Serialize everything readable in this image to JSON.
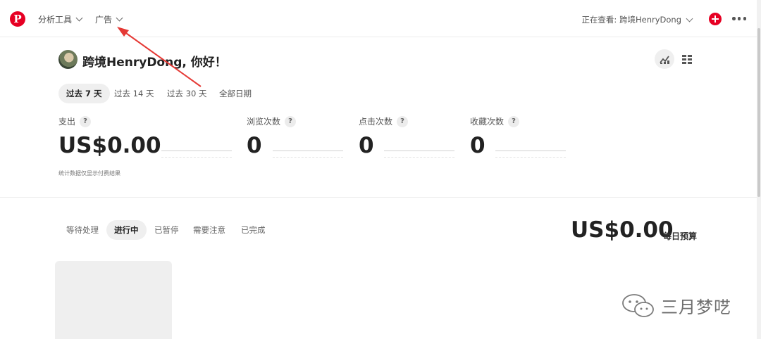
{
  "header": {
    "logo_letter": "P",
    "nav": [
      {
        "label": "分析工具"
      },
      {
        "label": "广告"
      }
    ],
    "viewing_label": "正在查看: 跨境HenryDong",
    "brand_color": "#e60023"
  },
  "greeting": {
    "text": "跨境HenryDong, 你好！"
  },
  "date_tabs": [
    {
      "label": "过去 7 天",
      "active": true
    },
    {
      "label": "过去 14 天",
      "active": false
    },
    {
      "label": "过去 30 天",
      "active": false
    },
    {
      "label": "全部日期",
      "active": false
    }
  ],
  "metrics": [
    {
      "label": "支出",
      "value": "US$0.00"
    },
    {
      "label": "浏览次数",
      "value": "0"
    },
    {
      "label": "点击次数",
      "value": "0"
    },
    {
      "label": "收藏次数",
      "value": "0"
    }
  ],
  "help_mark": "?",
  "footnote": "统计数据仅显示付费结果",
  "status_tabs": [
    {
      "label": "等待处理",
      "active": false
    },
    {
      "label": "进行中",
      "active": true
    },
    {
      "label": "已暂停",
      "active": false
    },
    {
      "label": "需要注意",
      "active": false
    },
    {
      "label": "已完成",
      "active": false
    }
  ],
  "budget": {
    "amount": "US$0.00",
    "label": "每日预算"
  },
  "watermark": {
    "text": "三月梦呓"
  }
}
